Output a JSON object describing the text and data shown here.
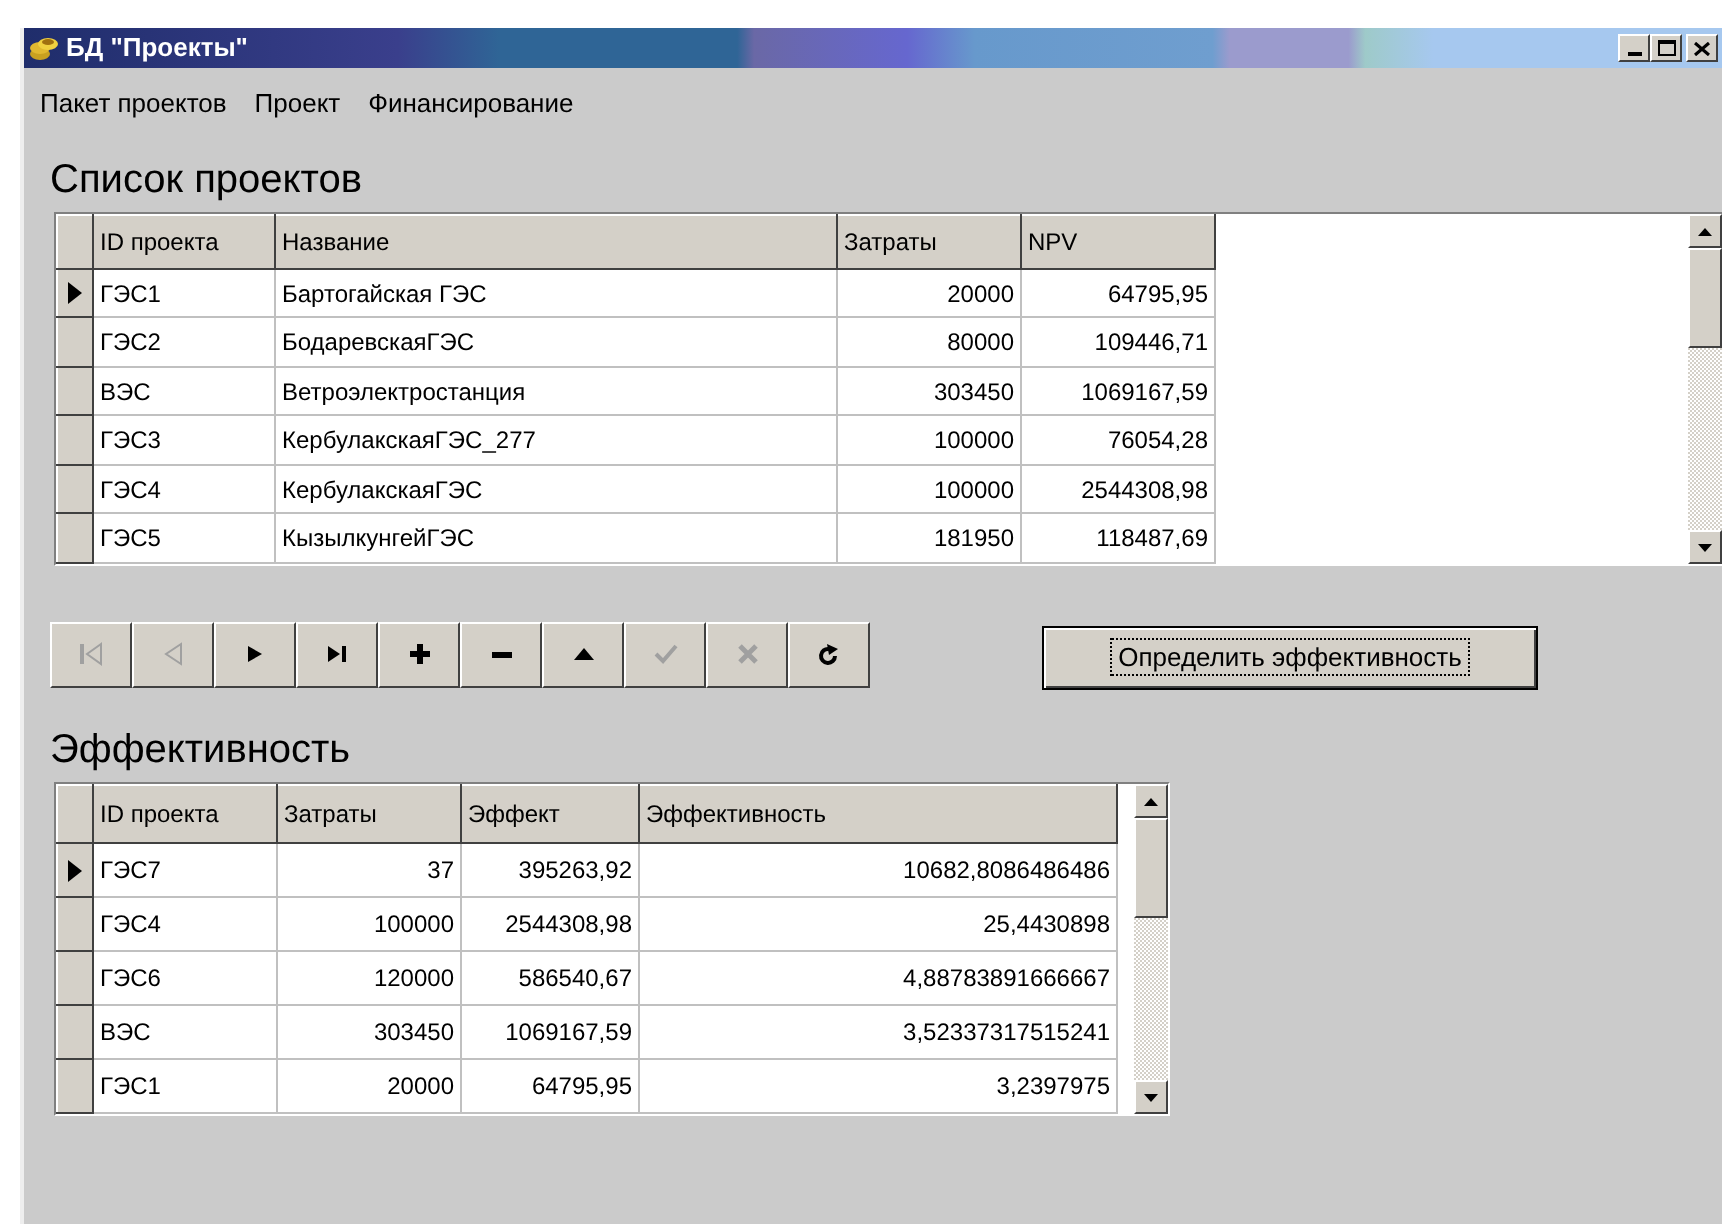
{
  "window": {
    "title": "БД \"Проекты\""
  },
  "menu": [
    {
      "label": "Пакет проектов"
    },
    {
      "label": "Проект"
    },
    {
      "label": "Финансирование"
    }
  ],
  "projects": {
    "heading": "Список проектов",
    "columns": [
      {
        "label": "ID проекта",
        "kind": "text"
      },
      {
        "label": "Название",
        "kind": "text"
      },
      {
        "label": "Затраты",
        "kind": "number"
      },
      {
        "label": "NPV",
        "kind": "number"
      }
    ],
    "rows": [
      {
        "selected": true,
        "cells": [
          "ГЭС1",
          "Бартогайская ГЭС",
          "20000",
          "64795,95"
        ]
      },
      {
        "selected": false,
        "cells": [
          "ГЭС2",
          "БодаревскаяГЭС",
          "80000",
          "109446,71"
        ]
      },
      {
        "selected": false,
        "cells": [
          "ВЭС",
          "Ветроэлектростанция",
          "303450",
          "1069167,59"
        ]
      },
      {
        "selected": false,
        "cells": [
          "ГЭС3",
          "КербулакскаяГЭС_277",
          "100000",
          "76054,28"
        ]
      },
      {
        "selected": false,
        "cells": [
          "ГЭС4",
          "КербулакскаяГЭС",
          "100000",
          "2544308,98"
        ]
      },
      {
        "selected": false,
        "cells": [
          "ГЭС5",
          "КызылкунгейГЭС",
          "181950",
          "118487,69"
        ]
      }
    ]
  },
  "navigator": [
    {
      "kind": "first",
      "disabled": true
    },
    {
      "kind": "prior",
      "disabled": true
    },
    {
      "kind": "next",
      "disabled": false
    },
    {
      "kind": "last",
      "disabled": false
    },
    {
      "kind": "insert",
      "disabled": false
    },
    {
      "kind": "delete",
      "disabled": false
    },
    {
      "kind": "edit",
      "disabled": false
    },
    {
      "kind": "post",
      "disabled": true
    },
    {
      "kind": "cancel",
      "disabled": true
    },
    {
      "kind": "refresh",
      "disabled": false
    }
  ],
  "action_button": {
    "label": "Определить эффективность"
  },
  "efficiency": {
    "heading": "Эффективность",
    "columns": [
      {
        "label": "ID проекта",
        "kind": "text"
      },
      {
        "label": "Затраты",
        "kind": "number"
      },
      {
        "label": "Эффект",
        "kind": "number"
      },
      {
        "label": "Эффективность",
        "kind": "number"
      }
    ],
    "rows": [
      {
        "selected": true,
        "cells": [
          "ГЭС7",
          "37",
          "395263,92",
          "10682,8086486486"
        ]
      },
      {
        "selected": false,
        "cells": [
          "ГЭС4",
          "100000",
          "2544308,98",
          "25,4430898"
        ]
      },
      {
        "selected": false,
        "cells": [
          "ГЭС6",
          "120000",
          "586540,67",
          "4,88783891666667"
        ]
      },
      {
        "selected": false,
        "cells": [
          "ВЭС",
          "303450",
          "1069167,59",
          "3,52337317515241"
        ]
      },
      {
        "selected": false,
        "cells": [
          "ГЭС1",
          "20000",
          "64795,95",
          "3,2397975"
        ]
      }
    ]
  }
}
